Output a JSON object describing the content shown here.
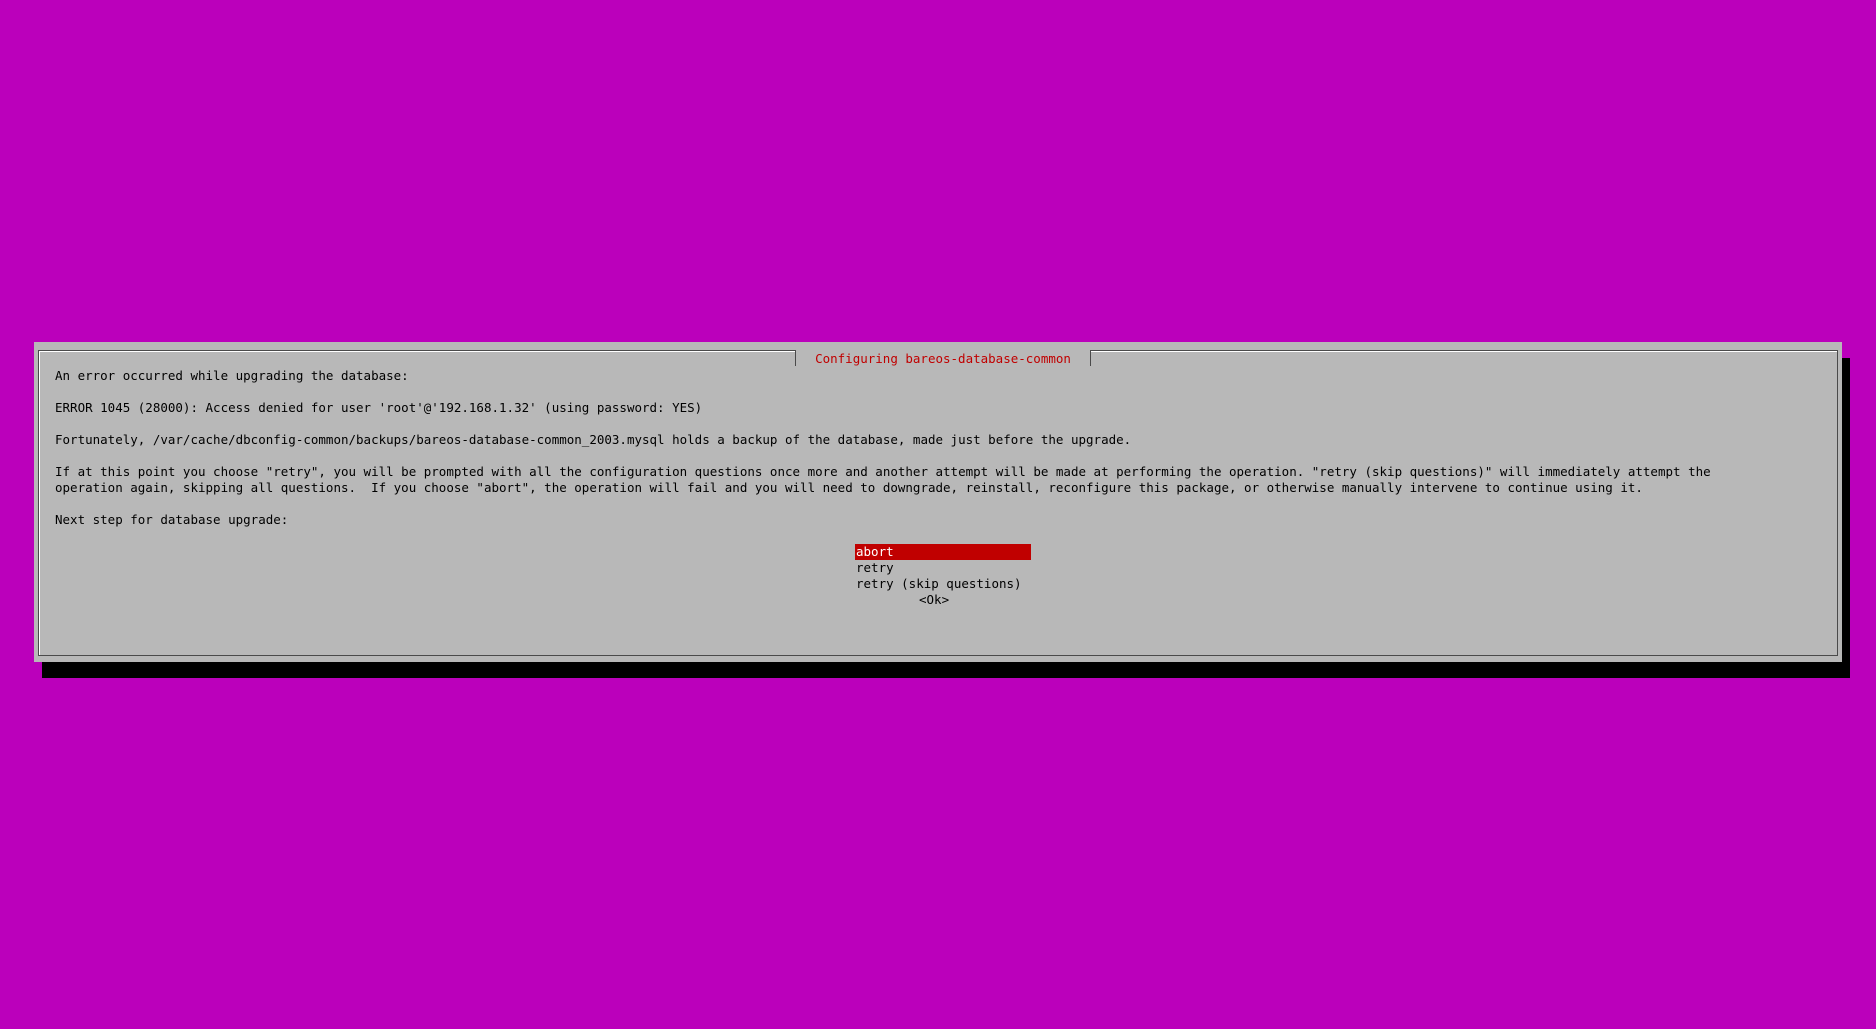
{
  "dialog": {
    "title": "Configuring bareos-database-common",
    "lines": [
      "An error occurred while upgrading the database:",
      "ERROR 1045 (28000): Access denied for user 'root'@'192.168.1.32' (using password: YES)",
      "Fortunately, /var/cache/dbconfig-common/backups/bareos-database-common_2003.mysql holds a backup of the database, made just before the upgrade.",
      "If at this point you choose \"retry\", you will be prompted with all the configuration questions once more and another attempt will be made at performing the operation. \"retry (skip questions)\" will immediately attempt the",
      "operation again, skipping all questions.  If you choose \"abort\", the operation will fail and you will need to downgrade, reinstall, reconfigure this package, or otherwise manually intervene to continue using it.",
      "Next step for database upgrade:"
    ],
    "options": [
      {
        "label": "abort",
        "selected": true
      },
      {
        "label": "retry",
        "selected": false
      },
      {
        "label": "retry (skip questions)",
        "selected": false
      }
    ],
    "ok_label": "<Ok>"
  },
  "colors": {
    "background": "#bb00bb",
    "dialog": "#b8b8b8",
    "accent": "#c00000",
    "shadow": "#000000"
  }
}
